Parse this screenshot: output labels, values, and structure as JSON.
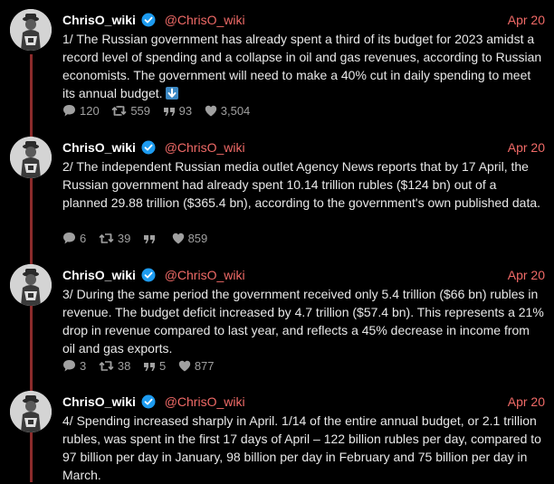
{
  "colors": {
    "background": "#000000",
    "accent": "#f06a67",
    "thread_line": "#8b2b2b",
    "verified": "#1d9bf0",
    "muted": "#a0a0a0"
  },
  "tweets": [
    {
      "author": "ChrisO_wiki",
      "handle": "@ChrisO_wiki",
      "date": "Apr 20",
      "text": "1/ The Russian government has already spent a third of its budget for 2023 amidst a record level of spending and a collapse in oil and gas revenues, according to Russian economists. The government will need to make a 40% cut in daily spending to meet its annual budget.",
      "emoji": "down-arrow-emoji",
      "replies": "120",
      "retweets": "559",
      "quotes": "93",
      "likes": "3,504"
    },
    {
      "author": "ChrisO_wiki",
      "handle": "@ChrisO_wiki",
      "date": "Apr 20",
      "text": "2/ The independent Russian media outlet Agency News reports that by 17 April, the Russian government had already spent 10.14 trillion rubles ($124 bn) out of a planned 29.88 trillion ($365.4 bn), according to the government's own published data.",
      "replies": "6",
      "retweets": "39",
      "quotes": "",
      "likes": "859"
    },
    {
      "author": "ChrisO_wiki",
      "handle": "@ChrisO_wiki",
      "date": "Apr 20",
      "text": "3/ During the same period the government received only 5.4 trillion ($66 bn) rubles in revenue. The budget deficit increased by 4.7 trillion ($57.4 bn). This represents a 21% drop in revenue compared to last year, and reflects a 45% decrease in income from oil and gas exports.",
      "replies": "3",
      "retweets": "38",
      "quotes": "5",
      "likes": "877"
    },
    {
      "author": "ChrisO_wiki",
      "handle": "@ChrisO_wiki",
      "date": "Apr 20",
      "text": "4/ Spending increased sharply in April. 1/14 of the entire annual budget, or 2.1 trillion rubles, was spent in the first 17 days of April – 122 billion rubles per day, compared to 97 billion per day in January, 98 billion per day in February and 75 billion per day in March."
    }
  ]
}
